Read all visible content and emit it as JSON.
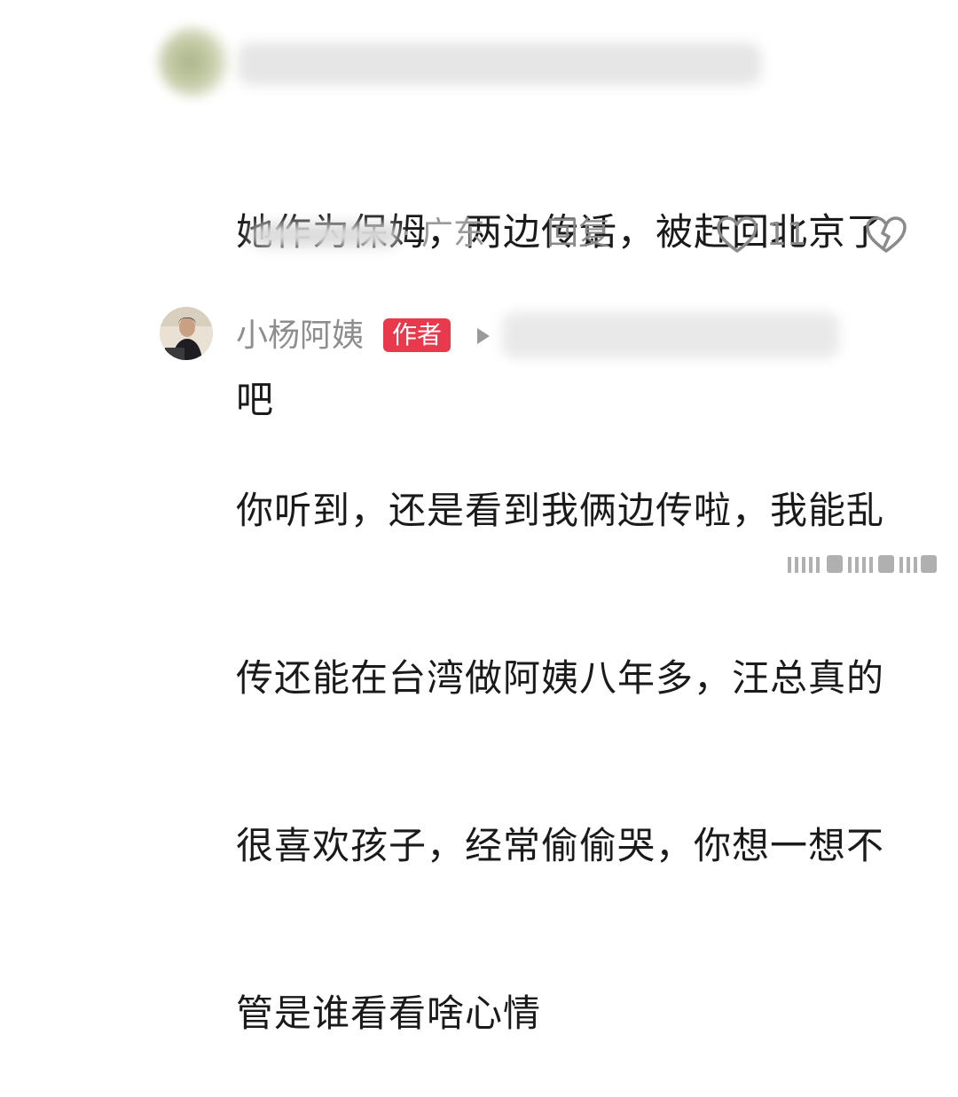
{
  "comment1": {
    "text_line1": "她作为保姆，两边传话，被赶回北京了",
    "text_line2": "吧",
    "location": "· 广东",
    "reply_label": "回复",
    "like_count": "11"
  },
  "comment2": {
    "author": "小杨阿姨",
    "author_badge": "作者",
    "lines": [
      "你听到，还是看到我俩边传啦，我能乱",
      "传还能在台湾做阿姨八年多，汪总真的",
      "很喜欢孩子，经常偷偷哭，你想一想不",
      "管是谁看看啥心情"
    ]
  },
  "colors": {
    "badge": "#e8394d",
    "meta_text": "#9a9a9a",
    "body_text": "#1a1a1a"
  },
  "icons": [
    "heart-outline-icon",
    "broken-heart-icon",
    "play-triangle-icon"
  ]
}
